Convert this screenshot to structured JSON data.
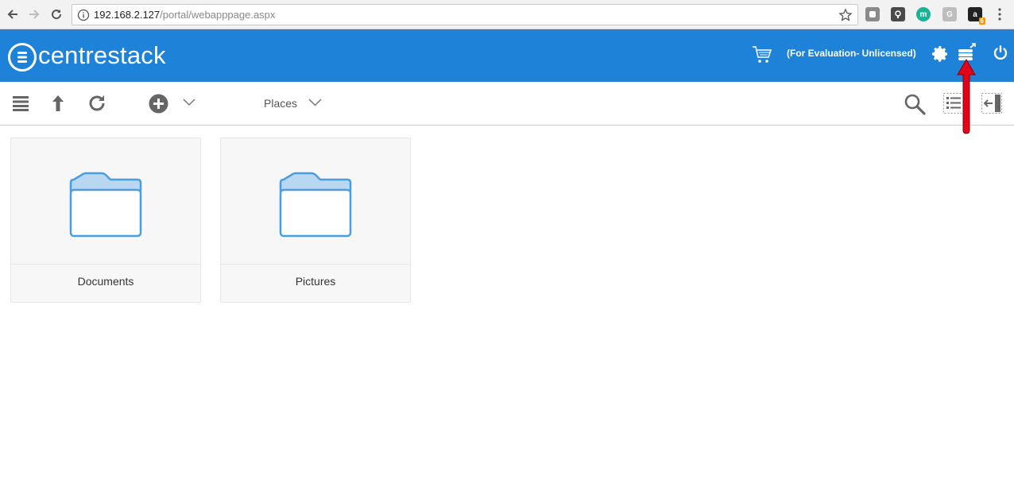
{
  "browser": {
    "url_host": "192.168.2.127",
    "url_path": "/portal/webapppage.aspx",
    "extensions": [
      {
        "name": "pocket-extension-icon",
        "color": "#8a8a8a",
        "glyph": ""
      },
      {
        "name": "lastpass-extension-icon",
        "color": "#4a4a4a",
        "glyph": ""
      },
      {
        "name": "m-extension-icon",
        "color": "#1ab394",
        "glyph": "m"
      },
      {
        "name": "g-extension-icon",
        "color": "#bdbdbd",
        "glyph": "G"
      },
      {
        "name": "amazon-extension-icon",
        "color": "#222222",
        "glyph": "a",
        "badge": "6"
      }
    ]
  },
  "header": {
    "brand": "centrestack",
    "license_status": "(For Evaluation- Unlicensed)",
    "brand_color": "#1e82d8"
  },
  "toolbar": {
    "places_label": "Places"
  },
  "folders": [
    {
      "label": "Documents"
    },
    {
      "label": "Pictures"
    }
  ],
  "icons": {
    "folder_color": "#4a9ee0",
    "annotation_color": "#e3001b"
  }
}
